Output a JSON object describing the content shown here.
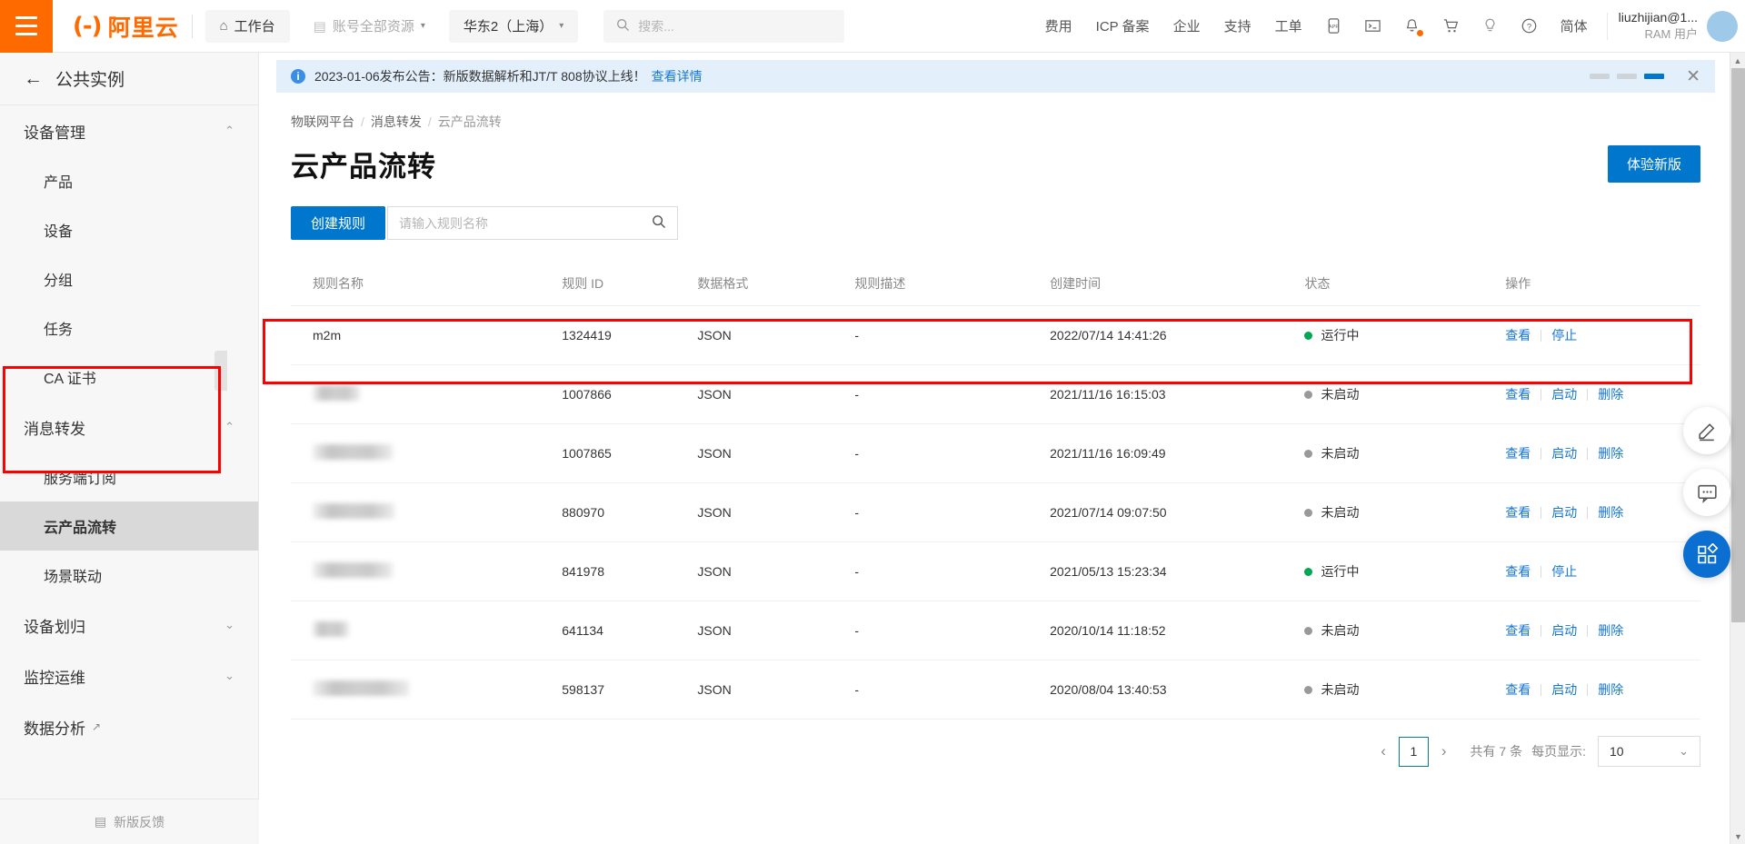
{
  "header": {
    "menu_icon": "hamburger-icon",
    "logo_mark": "(-)",
    "logo_text": "阿里云",
    "workbench": "工作台",
    "resources": "账号全部资源",
    "region": "华东2（上海）",
    "search_placeholder": "搜索...",
    "links": [
      "费用",
      "ICP 备案",
      "企业",
      "支持",
      "工单"
    ],
    "icons": [
      "app-icon",
      "terminal-icon",
      "bell-icon"
    ],
    "right_icons": [
      "cart-icon",
      "lightbulb-icon",
      "help-icon"
    ],
    "language": "简体",
    "user_name": "liuzhijian@1...",
    "user_role": "RAM 用户"
  },
  "sidebar": {
    "back_label": "公共实例",
    "groups": [
      {
        "label": "设备管理",
        "expanded": true,
        "items": [
          "产品",
          "设备",
          "分组",
          "任务",
          "CA 证书"
        ]
      },
      {
        "label": "消息转发",
        "expanded": true,
        "items": [
          "服务端订阅",
          "云产品流转",
          "场景联动"
        ]
      }
    ],
    "collapsed": [
      "设备划归",
      "监控运维"
    ],
    "external": "数据分析",
    "footer": "新版反馈",
    "active_item": "云产品流转"
  },
  "banner": {
    "text": "2023-01-06发布公告：新版数据解析和JT/T 808协议上线！",
    "link": "查看详情",
    "dots": 3,
    "active_dot": 3,
    "close_icon": "close-icon"
  },
  "breadcrumb": [
    "物联网平台",
    "消息转发",
    "云产品流转"
  ],
  "page": {
    "title": "云产品流转",
    "new_version_button": "体验新版",
    "create_button": "创建规则",
    "search_placeholder": "请输入规则名称"
  },
  "table": {
    "columns": [
      "规则名称",
      "规则 ID",
      "数据格式",
      "规则描述",
      "创建时间",
      "状态",
      "操作"
    ],
    "rows": [
      {
        "name": "m2m",
        "redacted": false,
        "redact_width": 0,
        "id": "1324419",
        "format": "JSON",
        "desc": "-",
        "created": "2022/07/14 14:41:26",
        "status": "运行中",
        "status_type": "run",
        "ops": [
          "查看",
          "停止"
        ]
      },
      {
        "name": "",
        "redacted": true,
        "redact_width": 52,
        "id": "1007866",
        "format": "JSON",
        "desc": "-",
        "created": "2021/11/16 16:15:03",
        "status": "未启动",
        "status_type": "stop",
        "ops": [
          "查看",
          "启动",
          "删除"
        ]
      },
      {
        "name": "",
        "redacted": true,
        "redact_width": 88,
        "id": "1007865",
        "format": "JSON",
        "desc": "-",
        "created": "2021/11/16 16:09:49",
        "status": "未启动",
        "status_type": "stop",
        "ops": [
          "查看",
          "启动",
          "删除"
        ]
      },
      {
        "name": "",
        "redacted": true,
        "redact_width": 90,
        "id": "880970",
        "format": "JSON",
        "desc": "-",
        "created": "2021/07/14 09:07:50",
        "status": "未启动",
        "status_type": "stop",
        "ops": [
          "查看",
          "启动",
          "删除"
        ]
      },
      {
        "name": "",
        "redacted": true,
        "redact_width": 88,
        "id": "841978",
        "format": "JSON",
        "desc": "-",
        "created": "2021/05/13 15:23:34",
        "status": "运行中",
        "status_type": "run",
        "ops": [
          "查看",
          "停止"
        ]
      },
      {
        "name": "",
        "redacted": true,
        "redact_width": 40,
        "id": "641134",
        "format": "JSON",
        "desc": "-",
        "created": "2020/10/14 11:18:52",
        "status": "未启动",
        "status_type": "stop",
        "ops": [
          "查看",
          "启动",
          "删除"
        ]
      },
      {
        "name": "",
        "redacted": true,
        "redact_width": 106,
        "id": "598137",
        "format": "JSON",
        "desc": "-",
        "created": "2020/08/04 13:40:53",
        "status": "未启动",
        "status_type": "stop",
        "ops": [
          "查看",
          "启动",
          "删除"
        ]
      }
    ]
  },
  "pagination": {
    "prev_icon": "chevron-left-icon",
    "next_icon": "chevron-right-icon",
    "current_page": "1",
    "total_text": "共有 7 条",
    "per_page_label": "每页显示:",
    "per_page_value": "10"
  },
  "floats": [
    "pencil-icon",
    "chat-icon",
    "apps-icon"
  ],
  "colors": {
    "brand_orange": "#ff6a00",
    "primary_blue": "#0077cc",
    "link_blue": "#1677d2",
    "status_running": "#00a854",
    "status_stopped": "#999999",
    "highlight_red": "#ff0000"
  }
}
